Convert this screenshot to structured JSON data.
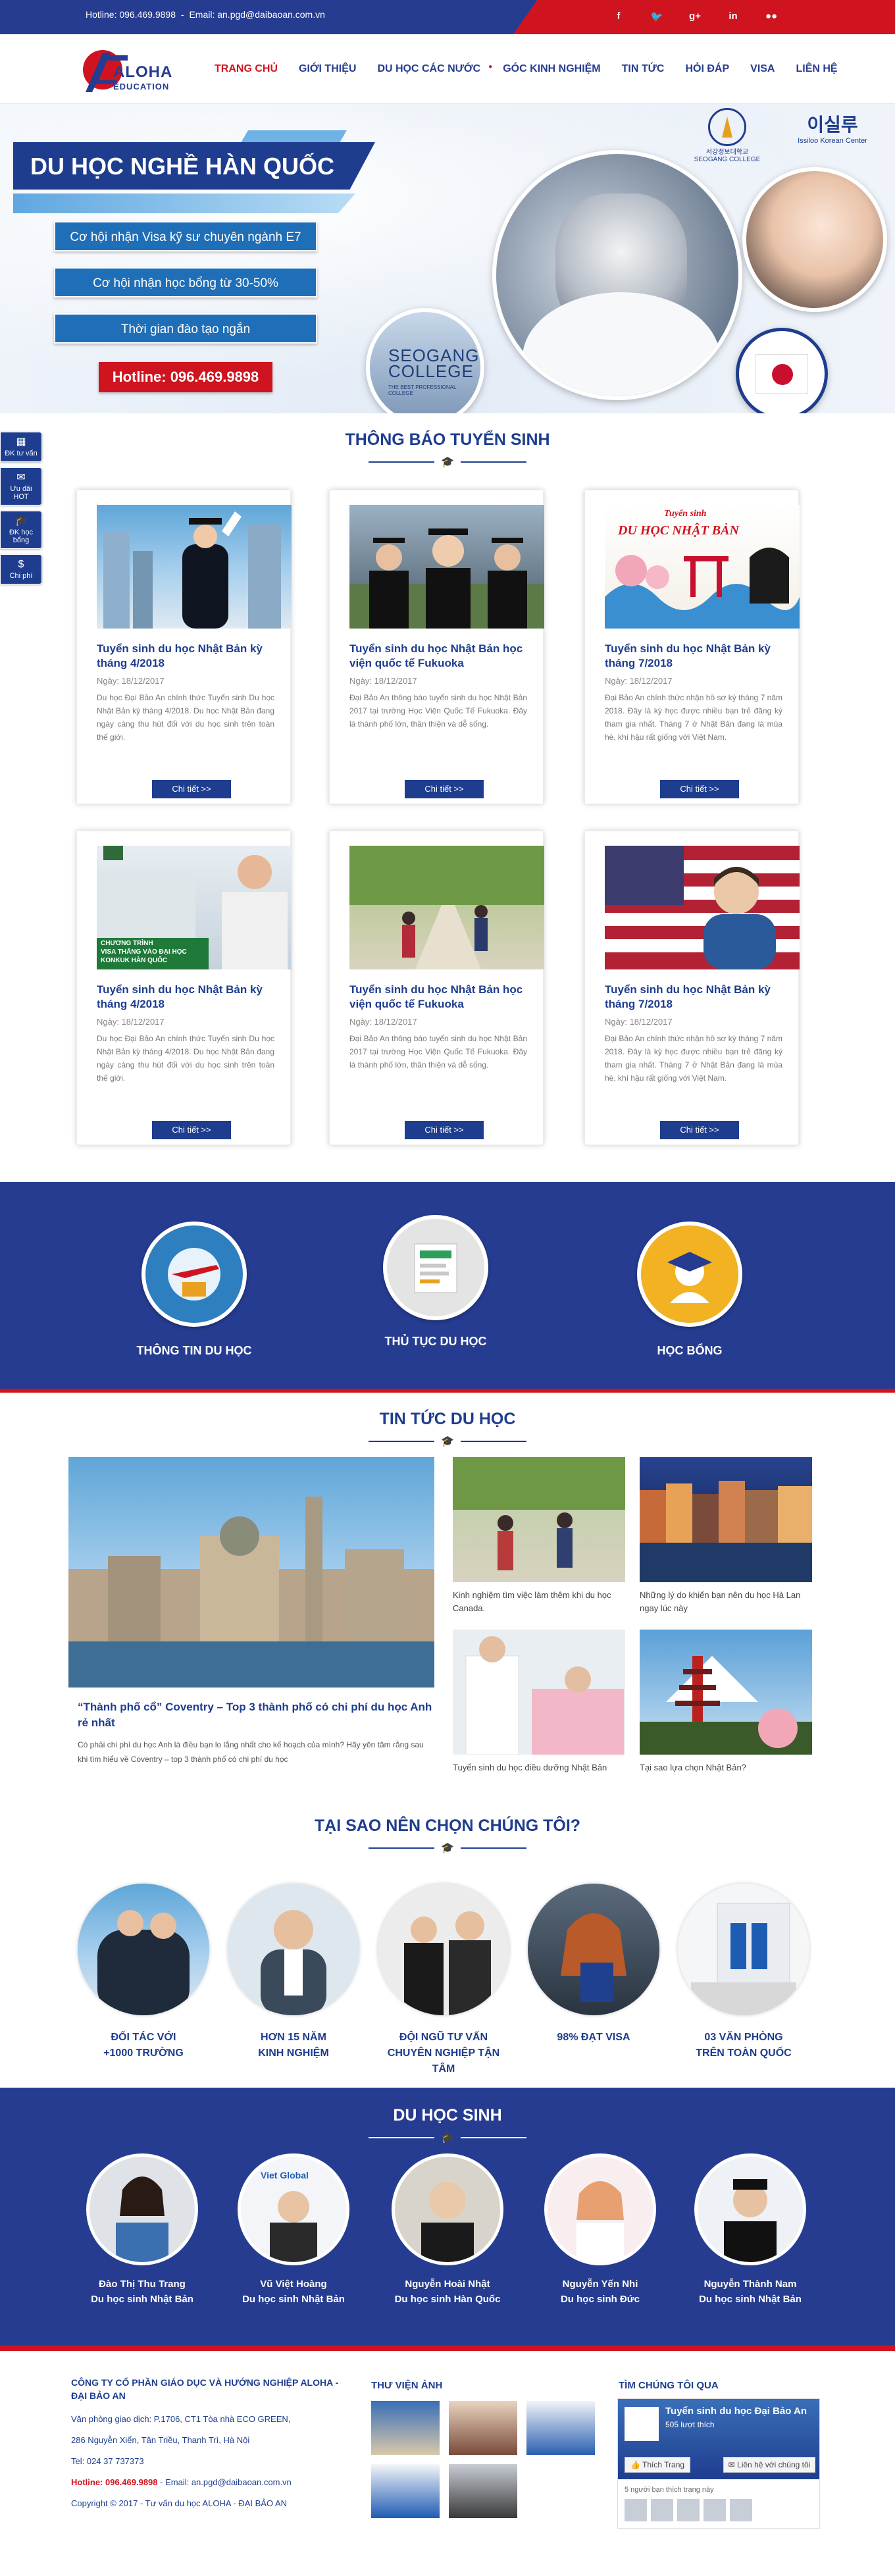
{
  "topbar": {
    "hotline": "Hotline: 096.469.9898",
    "sep": "-",
    "email": "Email: an.pgd@daibaoan.com.vn",
    "socials": [
      "f",
      "t",
      "g+",
      "in",
      "flickr"
    ]
  },
  "logo": {
    "name": "ALOHA",
    "sub": "EDUCATION"
  },
  "nav": [
    "TRANG CHỦ",
    "GIỚI THIỆU",
    "DU HỌC CÁC NƯỚC",
    "GÓC KINH NGHIỆM",
    "TIN TỨC",
    "HỎI ĐÁP",
    "VISA",
    "LIÊN HỆ"
  ],
  "hero": {
    "title": "DU HỌC NGHỀ HÀN QUỐC",
    "points": [
      "Cơ hội nhận Visa kỹ sư chuyên ngành E7",
      "Cơ hội nhận học bổng từ 30-50%",
      "Thời gian đào tạo ngắn"
    ],
    "hotline": "Hotline: 096.469.9898",
    "college": "SEOGANG\nCOLLEGE",
    "college_sub": "THE BEST PROFESSIONAL COLLEGE",
    "partner1": "서강정보대학교 SEOGANG COLLEGE",
    "partner2": "Issiloo Korean Center",
    "partner2_glyph": "이실루"
  },
  "fixbar": [
    {
      "icon": "calendar-icon",
      "label": "ĐK tư vấn"
    },
    {
      "icon": "gift-icon",
      "label": "Ưu đãi HOT"
    },
    {
      "icon": "graduation-icon",
      "label": "ĐK học bổng"
    },
    {
      "icon": "dollar-icon",
      "label": "Chi phí"
    }
  ],
  "admission": {
    "title": "THÔNG BÁO TUYỂN SINH",
    "cards": [
      {
        "title": "Tuyển sinh du học Nhật Bản kỳ tháng 4/2018",
        "date": "Ngày: 18/12/2017",
        "desc": "Du học Đại Bảo An chính thức Tuyển sinh Du học Nhật Bản kỳ tháng 4/2018. Du học Nhật Bản đang ngày càng thu hút đối với du học sinh trên toàn thế giới.",
        "more": "Chi tiết >>"
      },
      {
        "title": "Tuyển sinh du học Nhật Bản học viện quốc tế Fukuoka",
        "date": "Ngày: 18/12/2017",
        "desc": "Đại Bảo An thông báo tuyển sinh du học Nhật Bản 2017 tại trường Học Viện Quốc Tế Fukuoka. Đây là thành phố lớn, thân thiện và dễ sống.",
        "more": "Chi tiết >>"
      },
      {
        "title": "Tuyển sinh du học Nhật Bản kỳ tháng 7/2018",
        "date": "Ngày: 18/12/2017",
        "desc": "Đại Bảo An chính thức nhận hồ sơ kỳ tháng 7 năm 2018. Đây là kỳ học được nhiều bạn trẻ đăng ký tham gia nhất. Tháng 7 ở Nhật Bản đang là mùa hè, khí hậu rất giống với Việt Nam.",
        "more": "Chi tiết >>",
        "banner1": "Tuyển sinh",
        "banner2": "DU HỌC NHẬT BẢN"
      },
      {
        "title": "Tuyển sinh du học Nhật Bản kỳ tháng 4/2018",
        "date": "Ngày: 18/12/2017",
        "desc": "Du học Đại Bảo An chính thức Tuyển sinh Du học Nhật Bản kỳ tháng 4/2018. Du học Nhật Bản đang ngày càng thu hút đối với du học sinh trên toàn thế giới.",
        "more": "Chi tiết >>",
        "banner1": "CHƯƠNG TRÌNH",
        "banner2": "VISA THẲNG VÀO ĐẠI HỌC",
        "banner3": "KONKUK HÀN QUỐC"
      },
      {
        "title": "Tuyển sinh du học Nhật Bản học viện quốc tế Fukuoka",
        "date": "Ngày: 18/12/2017",
        "desc": "Đại Bảo An thông báo tuyển sinh du học Nhật Bản 2017 tại trường Học Viện Quốc Tế Fukuoka. Đây là thành phố lớn, thân thiện và dễ sống.",
        "more": "Chi tiết >>"
      },
      {
        "title": "Tuyển sinh du học Nhật Bản kỳ tháng 7/2018",
        "date": "Ngày: 18/12/2017",
        "desc": "Đại Bảo An chính thức nhận hồ sơ kỳ tháng 7 năm 2018. Đây là kỳ học được nhiều bạn trẻ đăng ký tham gia nhất. Tháng 7 ở Nhật Bản đang là mùa hè, khí hậu rất giống với Việt Nam.",
        "more": "Chi tiết >>"
      }
    ]
  },
  "services": [
    "THÔNG TIN DU HỌC",
    "THỦ TỤC DU HỌC",
    "HỌC BỔNG"
  ],
  "news": {
    "title": "TIN TỨC DU HỌC",
    "big": {
      "title": "“Thành phố cổ” Coventry – Top 3 thành phố có chi phí du học Anh rẻ nhất",
      "desc": "Có phải chi phí du học Anh là điều bạn lo lắng nhất cho kế hoạch của mình? Hãy yên tâm rằng sau khi tìm hiểu về Coventry – top 3 thành phố có chi phí du học"
    },
    "small": [
      "Kinh nghiệm tìm việc làm thêm khi du học Canada.",
      "Những lý do khiến bạn nên du học Hà Lan ngay lúc này",
      "Tuyển sinh du học điều dưỡng Nhật Bản",
      "Tại sao lựa chọn Nhật Bản?"
    ]
  },
  "why": {
    "title": "TẠI SAO NÊN CHỌN CHÚNG TÔI?",
    "items": [
      {
        "l1": "ĐỐI TÁC VỚI",
        "l2": "+1000 TRƯỜNG"
      },
      {
        "l1": "HƠN 15 NĂM",
        "l2": "KINH NGHIỆM"
      },
      {
        "l1": "ĐỘI NGŨ TƯ VẤN",
        "l2": "CHUYÊN NGHIỆP TẬN TÂM"
      },
      {
        "l1": "98% ĐẠT VISA",
        "l2": ""
      },
      {
        "l1": "03 VĂN PHÒNG",
        "l2": "TRÊN TOÀN QUỐC"
      }
    ]
  },
  "students": {
    "title": "DU HỌC SINH",
    "items": [
      {
        "name": "Đào Thị Thu Trang",
        "role": "Du học sinh Nhật Bản"
      },
      {
        "name": "Vũ Việt Hoàng",
        "role": "Du học sinh Nhật Bản",
        "badge": "Viet Global"
      },
      {
        "name": "Nguyễn Hoài Nhật",
        "role": "Du học sinh Hàn Quốc"
      },
      {
        "name": "Nguyễn Yến Nhi",
        "role": "Du học sinh Đức"
      },
      {
        "name": "Nguyễn Thành Nam",
        "role": "Du học sinh Nhật Bản"
      }
    ]
  },
  "footer": {
    "company": "CÔNG TY CỔ PHẦN GIÁO DỤC VÀ HƯỚNG NGHIỆP ALOHA - ĐẠI BẢO AN",
    "office": "Văn phòng giao dịch: P.1706, CT1 Tòa nhà ECO GREEN,",
    "address": "286 Nguyễn Xiển, Tân Triều, Thanh Trì, Hà Nội",
    "tel": "Tel: 024 37 737373",
    "hotline": "Hotline: 096.469.9898",
    "email": " - Email: an.pgd@daibaoan.com.vn",
    "copyright": "Copyright © 2017 - Tư vấn du học ALOHA - ĐẠI BẢO AN",
    "gallery_title": "THƯ VIỆN ẢNH",
    "find_title": "TÌM CHÚNG TÔI QUA",
    "fb": {
      "page": "Tuyển sinh du học Đại Bảo An",
      "likes": "505 lượt thích",
      "like": "Thích Trang",
      "contact": "Liên hệ với chúng tôi",
      "friends": "5 người bạn thích trang này"
    }
  },
  "colors": {
    "primary": "#263c91",
    "accent": "#d0141f"
  }
}
